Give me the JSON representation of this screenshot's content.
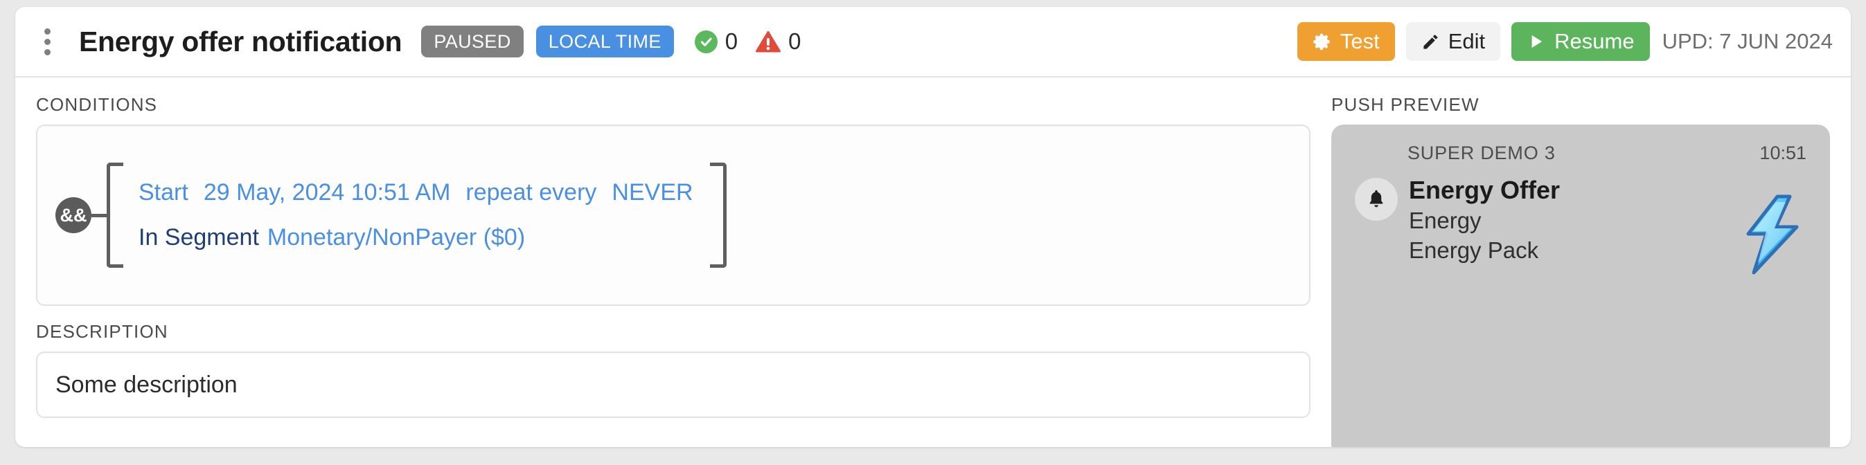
{
  "header": {
    "menu_icon": "kebab-menu-icon",
    "title": "Energy offer notification",
    "status_badge": "PAUSED",
    "time_badge": "LOCAL TIME",
    "ok_icon": "check-circle-icon",
    "ok_count": "0",
    "warn_icon": "warning-triangle-icon",
    "warn_count": "0",
    "buttons": {
      "test_label": "Test",
      "test_icon": "gear-icon",
      "edit_label": "Edit",
      "edit_icon": "pencil-icon",
      "resume_label": "Resume",
      "resume_icon": "play-icon"
    },
    "updated_text": "UPD: 7 JUN 2024"
  },
  "conditions": {
    "label": "CONDITIONS",
    "operator": "&&",
    "rows": [
      {
        "tokens": [
          {
            "text": "Start",
            "style": "blue"
          },
          {
            "text": "29 May, 2024 10:51 AM",
            "style": "blue"
          },
          {
            "text": "repeat every",
            "style": "blue"
          },
          {
            "text": "NEVER",
            "style": "blue"
          }
        ]
      },
      {
        "tokens": [
          {
            "text": "In Segment",
            "style": "navy"
          },
          {
            "text": "Monetary/NonPayer ($0)",
            "style": "blue"
          }
        ]
      }
    ]
  },
  "description": {
    "label": "DESCRIPTION",
    "value": "Some description"
  },
  "push_preview": {
    "label": "PUSH PREVIEW",
    "app_name": "SUPER DEMO 3",
    "time": "10:51",
    "bell_icon": "bell-icon",
    "title": "Energy Offer",
    "line1": "Energy",
    "line2": "Energy Pack",
    "image_icon": "lightning-bolt-icon"
  },
  "colors": {
    "page_bg": "#e9e9e9",
    "card_bg": "#ffffff",
    "paused_badge": "#808080",
    "localtime_badge": "#4a90e2",
    "ok_green": "#5cb85c",
    "warn_red": "#e04b3a",
    "test_orange": "#f0a030",
    "resume_green": "#5cb55c",
    "token_blue": "#4a90e2",
    "token_navy": "#1e3f73",
    "push_bg": "#c9c9c9"
  }
}
